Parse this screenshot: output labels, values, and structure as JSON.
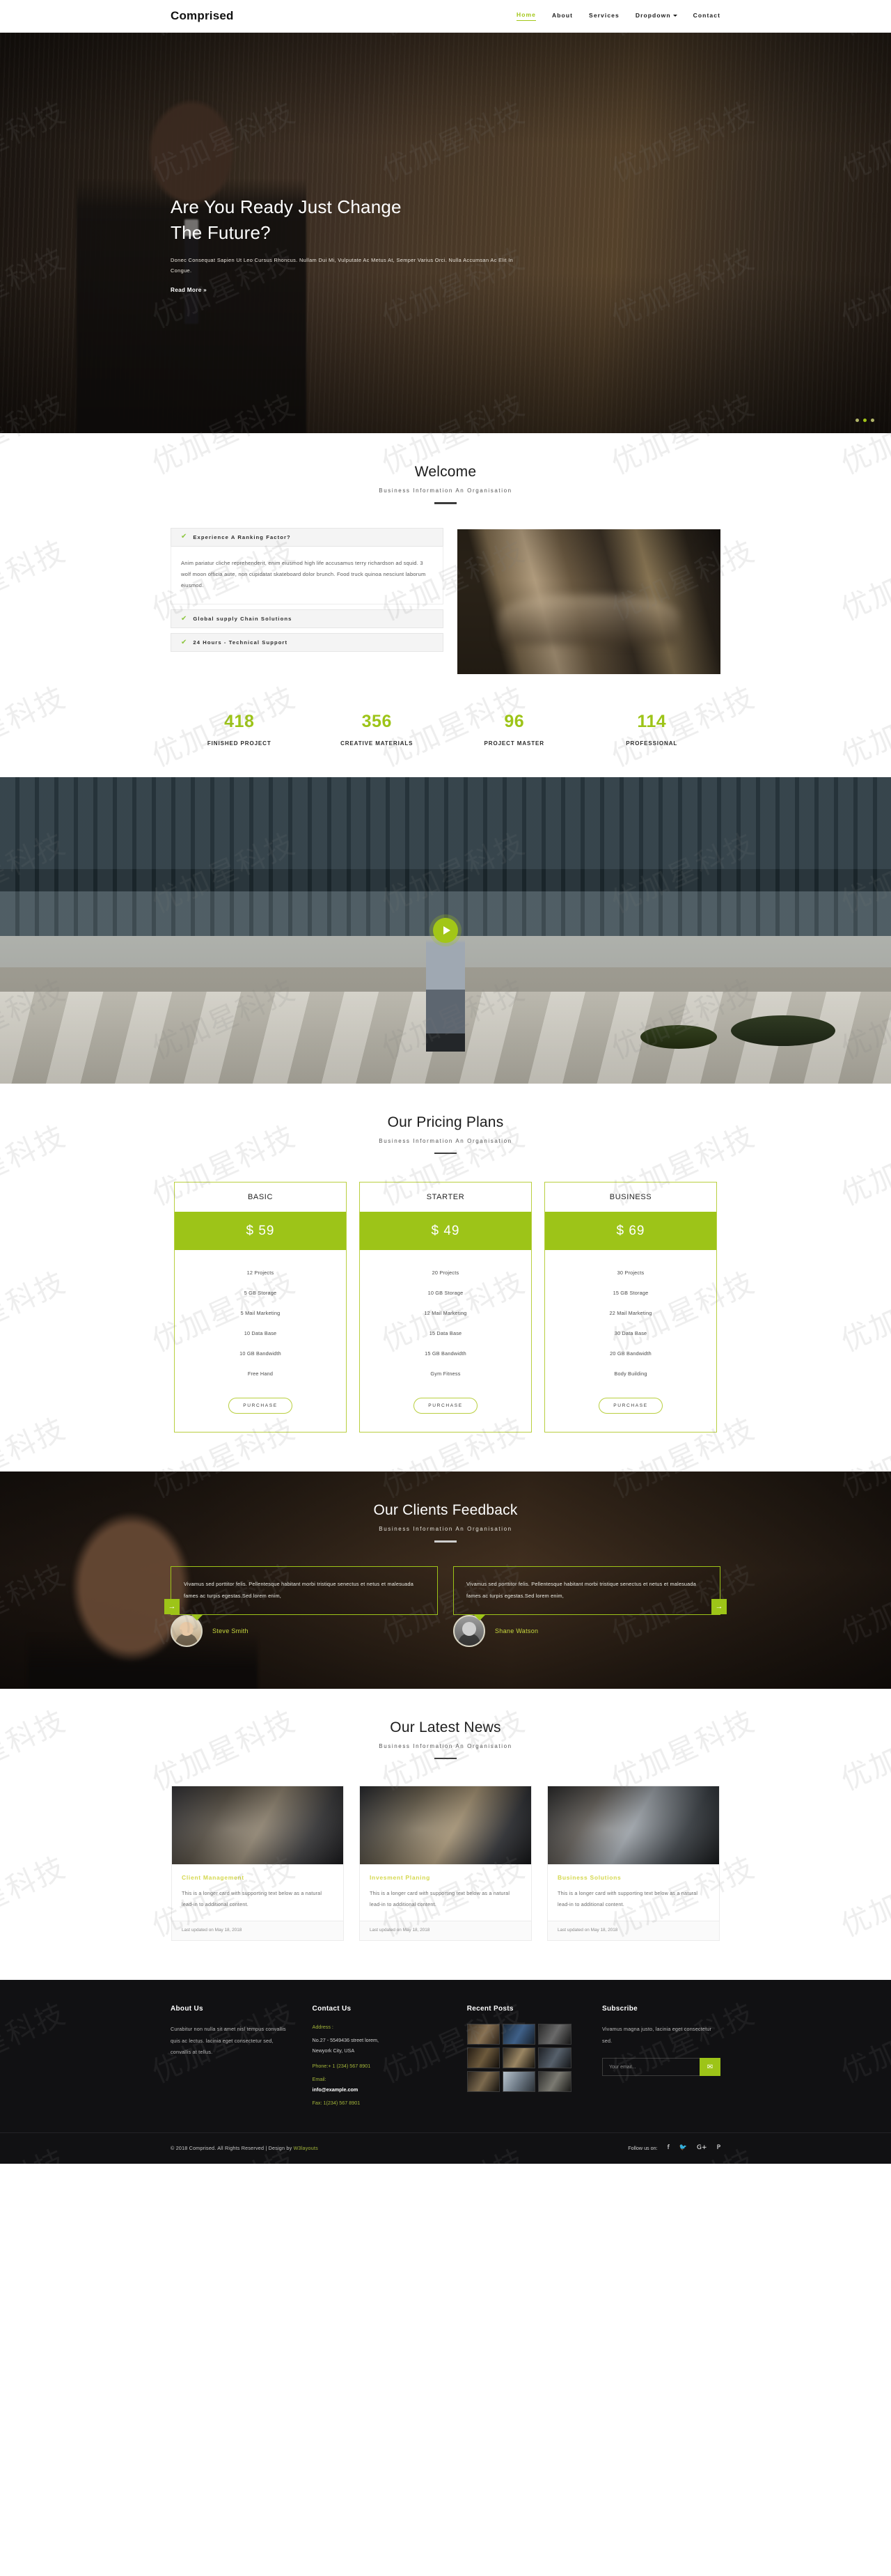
{
  "header": {
    "logo": "Comprised",
    "nav": [
      {
        "label": "Home",
        "active": true
      },
      {
        "label": "About",
        "active": false
      },
      {
        "label": "Services",
        "active": false
      },
      {
        "label": "Dropdown",
        "active": false,
        "caret": true
      },
      {
        "label": "Contact",
        "active": false
      }
    ]
  },
  "hero": {
    "title_line1": "Are You Ready Just Change",
    "title_line2": "The Future?",
    "paragraph": "Donec Consequat Sapien Ut Leo Cursus Rhoncus. Nullam Dui Mi, Vulputate Ac Metus At, Semper Varius Orci. Nulla Accumsan Ac Elit In Congue.",
    "cta": "Read More »"
  },
  "welcome": {
    "title": "Welcome",
    "subtitle": "Business Information An Organisation",
    "accordion": [
      {
        "label": "Experience A Ranking Factor?",
        "open": true,
        "body": "Anim pariatur cliche reprehenderit, enim eiusmod high life accusamus terry richardson ad squid. 3 wolf moon officia aute, non cupidatat skateboard dolor brunch. Food truck quinoa nesciunt laborum eiusmod."
      },
      {
        "label": "Global supply Chain Solutions",
        "open": false,
        "body": ""
      },
      {
        "label": "24 Hours - Technical Support",
        "open": false,
        "body": ""
      }
    ]
  },
  "counters": [
    {
      "number": "418",
      "label": "FINISHED PROJECT"
    },
    {
      "number": "356",
      "label": "CREATIVE MATERIALS"
    },
    {
      "number": "96",
      "label": "PROJECT MASTER"
    },
    {
      "number": "114",
      "label": "PROFESSIONAL"
    }
  ],
  "video": {
    "play_label": "play-video"
  },
  "pricing": {
    "title": "Our Pricing Plans",
    "subtitle": "Business Information An Organisation",
    "plans": [
      {
        "name": "BASIC",
        "price": "$ 59",
        "features": [
          "12 Projects",
          "5 GB Storage",
          "5 Mail Marketing",
          "10 Data Base",
          "10 GB Bandwidth",
          "Free Hand"
        ],
        "button": "PURCHASE"
      },
      {
        "name": "STARTER",
        "price": "$ 49",
        "features": [
          "20 Projects",
          "10 GB Storage",
          "12 Mail Marketing",
          "15 Data Base",
          "15 GB Bandwidth",
          "Gym Fitness"
        ],
        "button": "PURCHASE"
      },
      {
        "name": "BUSINESS",
        "price": "$ 69",
        "features": [
          "30 Projects",
          "15 GB Storage",
          "22 Mail Marketing",
          "30 Data Base",
          "20 GB Bandwidth",
          "Body Building"
        ],
        "button": "PURCHASE"
      }
    ]
  },
  "testimonials": {
    "title": "Our Clients Feedback",
    "subtitle": "Business Information An Organisation",
    "items": [
      {
        "quote": "Vivamus sed porttitor felis. Pellentesque habitant morbi tristique senectus et netus et malesuada fames ac turpis egestas.Sed lorem enim,",
        "name": "Steve Smith"
      },
      {
        "quote": "Vivamus sed porttitor felis. Pellentesque habitant morbi tristique senectus et netus et malesuada fames ac turpis egestas.Sed lorem enim,",
        "name": "Shane Watson"
      }
    ],
    "prev_icon": "→",
    "next_icon": "→"
  },
  "news": {
    "title": "Our Latest News",
    "subtitle": "Business Information An Organisation",
    "cards": [
      {
        "title": "Client Management",
        "text": "This is a longer card with supporting text below as a natural lead-in to additional content.",
        "footer": "Last updated on May 18, 2018"
      },
      {
        "title": "Invesment Planing",
        "text": "This is a longer card with supporting text below as a natural lead-in to additional content.",
        "footer": "Last updated on May 18, 2018"
      },
      {
        "title": "Business Solutions",
        "text": "This is a longer card with supporting text below as a natural lead-in to additional content.",
        "footer": "Last updated on May 18, 2018"
      }
    ]
  },
  "footer": {
    "about": {
      "title": "About Us",
      "text": "Curabitur non nulla sit amet nisl tempus convallis quis ac lectus. lacinia eget consectetur sed, convallis at tellus."
    },
    "contact": {
      "title": "Contact Us",
      "address_label": "Address :",
      "address_line1": "No.27 - 5549436 street lorem,",
      "address_line2": "Newyork City, USA",
      "phone": "Phone:+ 1 (234) 567 8901",
      "email_label": "Email:",
      "email": "info@example.com",
      "fax": "Fax: 1(234) 567 8901"
    },
    "recent": {
      "title": "Recent Posts"
    },
    "subscribe": {
      "title": "Subscribe",
      "text": "Vivamus magna justo, lacinia eget consectetur sed.",
      "placeholder": "Your email...",
      "button_icon": "✉"
    },
    "bottom": {
      "copyright": "© 2018 Comprised. All Rights Reserved | Design by ",
      "design_by": "W3layouts",
      "follow_label": "Follow us on:",
      "social": [
        "f",
        "🐦",
        "G+",
        "P"
      ]
    }
  },
  "watermark": {
    "text": "优加星科技"
  },
  "colors": {
    "accent_green": "#9dc418",
    "accent_green_light": "#a2c617",
    "news_title": "#d5d84f",
    "footer_bg": "#111113",
    "testimonial_name": "#c8d93f"
  }
}
